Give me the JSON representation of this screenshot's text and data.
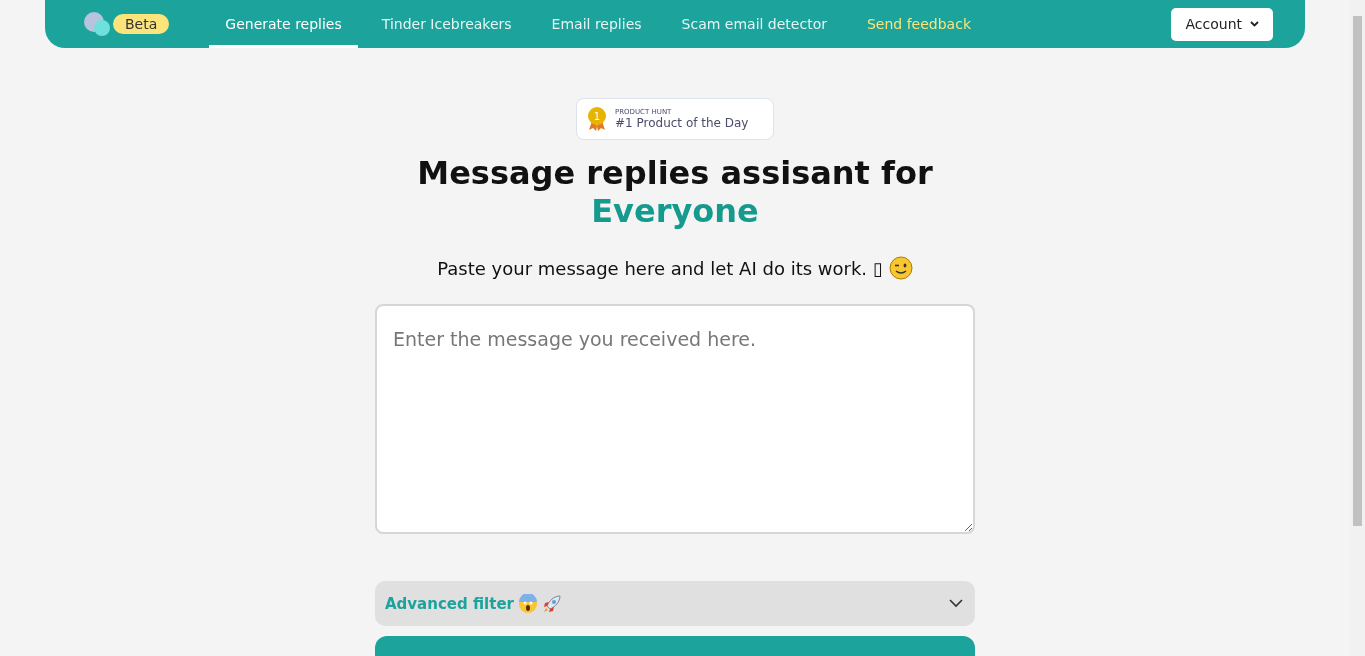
{
  "nav": {
    "badge": "Beta",
    "tabs": [
      {
        "label": "Generate replies",
        "selected": true
      },
      {
        "label": "Tinder Icebreakers",
        "selected": false
      },
      {
        "label": "Email replies",
        "selected": false
      },
      {
        "label": "Scam email detector",
        "selected": false
      },
      {
        "label": "Send feedback",
        "selected": false,
        "kind": "highlight"
      }
    ],
    "account_button": "Account"
  },
  "award": {
    "eyebrow": "PRODUCT HUNT",
    "title": "#1 Product of the Day",
    "rank": "1"
  },
  "headline": {
    "line1": "Message replies assisant for",
    "line2": "Everyone"
  },
  "subtitle": "Paste your message here and let AI do its work. ▯",
  "message_field": {
    "placeholder": "Enter the message you received here."
  },
  "advanced_filter": {
    "label": "Advanced filter",
    "expanded": false
  }
}
